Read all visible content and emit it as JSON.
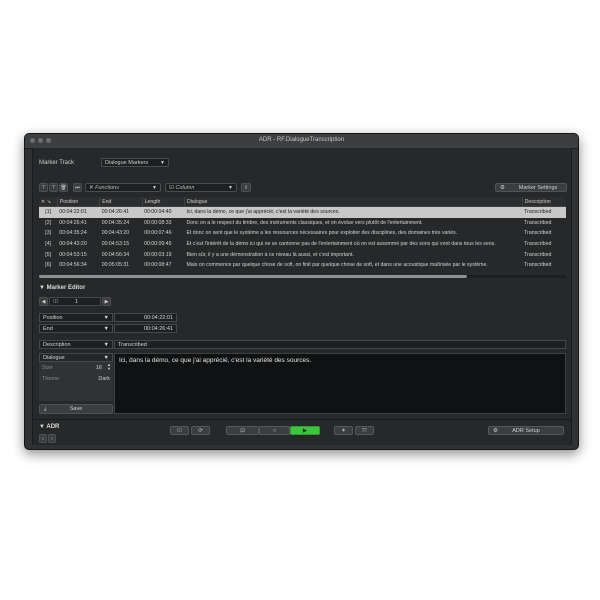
{
  "window": {
    "title": "ADR - RF.DialogueTranscription"
  },
  "marker_track": {
    "label": "Marker Track",
    "value": "Dialogue Markers"
  },
  "toolbar": {
    "functions_placeholder": "Functions",
    "column_placeholder": "Column",
    "marker_settings_label": "Marker Settings"
  },
  "table": {
    "headers": [
      "",
      "Position",
      "End",
      "Length",
      "Dialogue",
      "Description"
    ],
    "rows": [
      {
        "id": "[1]",
        "position": "00:04:22:01",
        "end": "00:04:26:41",
        "length": "00:00:04:40",
        "dialogue": "Ici, dans la démo, ce que j'ai apprécié, c'est la variété des sources.",
        "description": "Transcribed"
      },
      {
        "id": "[2]",
        "position": "00:04:26:41",
        "end": "00:04:35:24",
        "length": "00:00:08:33",
        "dialogue": "Donc on a le respect du timbre, des instruments classiques, et on évolue vers plutôt de l'entertainment.",
        "description": "Transcribed"
      },
      {
        "id": "[3]",
        "position": "00:04:35:24",
        "end": "00:04:43:20",
        "length": "00:00:07:46",
        "dialogue": "Et donc on sent que le système a les ressources nécessaires pour exploiter des disciplines, des domaines très variés.",
        "description": "Transcribed"
      },
      {
        "id": "[4]",
        "position": "00:04:43:20",
        "end": "00:04:53:15",
        "length": "00:00:09:45",
        "dialogue": "Et c'est l'intérêt de la démo ici qui ne se cantonne pas de l'entertainment où on est assommé par des sons qui vont dans tous les sens.",
        "description": "Transcribed"
      },
      {
        "id": "[5]",
        "position": "00:04:53:15",
        "end": "00:04:56:34",
        "length": "00:00:03:19",
        "dialogue": "Bien sûr, il y a une démonstration à ce niveau là aussi, et c'est important.",
        "description": "Transcribed"
      },
      {
        "id": "[6]",
        "position": "00:04:56:34",
        "end": "00:05:05:31",
        "length": "00:00:08:47",
        "dialogue": "Mais on commence par quelque chose de soft, on finit par quelque chose de soft, et dans une acoustique maîtrisée par le système.",
        "description": "Transcribed"
      }
    ]
  },
  "marker_editor": {
    "title": "Marker Editor",
    "id_label": "ID",
    "id_value": "1",
    "position_label": "Position",
    "position_value": "00:04:22:01",
    "end_label": "End",
    "end_value": "00:04:26:41",
    "description_label": "Description",
    "description_value": "Transcribed",
    "field_label": "Dialogue",
    "size_label": "Size",
    "size_value": "16",
    "theme_label": "Theme",
    "theme_value": "Dark",
    "save_label": "Save",
    "dialogue_text": "Ici, dans la démo, ce que j'ai apprécié, c'est la variété des sources."
  },
  "adr": {
    "title": "ADR",
    "id_button": "ID",
    "setup_label": "ADR Setup"
  },
  "colors": {
    "accent_green": "#3cc43c",
    "selection": "#c8c8c8"
  }
}
